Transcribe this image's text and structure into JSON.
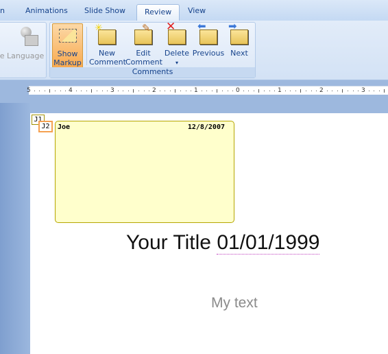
{
  "tabs": [
    {
      "label": "n"
    },
    {
      "label": "Animations"
    },
    {
      "label": "Slide Show"
    },
    {
      "label": "Review",
      "active": true
    },
    {
      "label": "View"
    }
  ],
  "ribbon": {
    "proofing": {
      "partial_label": "e",
      "language": "Language"
    },
    "comments": {
      "group_label": "Comments",
      "buttons": [
        {
          "line1": "Show",
          "line2": "Markup",
          "icon": "show-markup-icon",
          "active": true
        },
        {
          "line1": "New",
          "line2": "Comment",
          "icon": "new-comment-icon"
        },
        {
          "line1": "Edit",
          "line2": "Comment",
          "icon": "edit-comment-icon"
        },
        {
          "line1": "Delete",
          "line2": "▾",
          "icon": "delete-comment-icon"
        },
        {
          "line1": "Previous",
          "line2": "",
          "icon": "previous-comment-icon"
        },
        {
          "line1": "Next",
          "line2": "",
          "icon": "next-comment-icon"
        }
      ]
    }
  },
  "ruler": {
    "labels": [
      "5",
      "4",
      "3",
      "2",
      "1",
      "0",
      "1",
      "2",
      "3"
    ]
  },
  "slide": {
    "markers": [
      "J1",
      "J2"
    ],
    "comment": {
      "author": "Joe",
      "date": "12/8/2007"
    },
    "title_text": "Your Title ",
    "title_date": "01/01/1999",
    "body": "My text"
  },
  "colors": {
    "active_button": "#f8b65a",
    "comment_bg": "#ffffcc",
    "comment_border": "#b5a500"
  }
}
